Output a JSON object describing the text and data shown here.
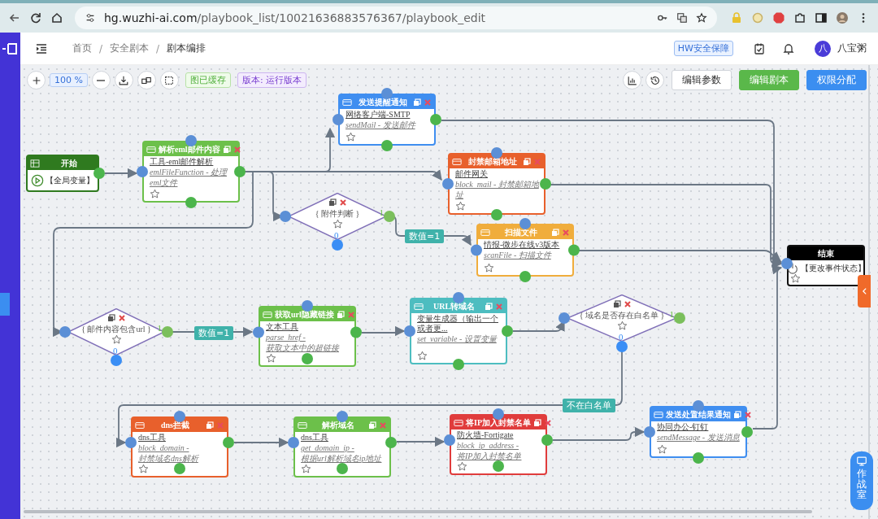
{
  "browser": {
    "host": "hg.wuzhi-ai.com",
    "path": "/playbook_list/10021636883576367/playbook_edit"
  },
  "header": {
    "breadcrumb": [
      {
        "label": "首页",
        "current": false
      },
      {
        "label": "安全剧本",
        "current": false
      },
      {
        "label": "剧本编排",
        "current": true
      }
    ],
    "separators": [
      "/",
      "/"
    ],
    "tag": "HW安全保障",
    "avatar_initial": "八",
    "user": "八宝粥"
  },
  "toolbar": {
    "zoom": "100 %",
    "cache_tag": "图已缓存",
    "version_tag": "版本: 运行版本",
    "buttons": [
      {
        "label": "编辑参数",
        "kind": "default"
      },
      {
        "label": "编辑剧本",
        "kind": "success"
      },
      {
        "label": "权限分配",
        "kind": "primary"
      }
    ]
  },
  "nodes": [
    {
      "kind": "start",
      "title": "开始",
      "body": "【全局变量】"
    },
    {
      "kind": "action",
      "title": "解析eml邮件内容",
      "color": "#6cc04a",
      "tool": "工具-eml邮件解析",
      "lines": [
        "emlFileFunction - 处理eml文件"
      ]
    },
    {
      "kind": "action",
      "title": "发送提醒通知",
      "color": "#3f8ef0",
      "tool": "网络客户端-SMTP",
      "lines": [
        "sendMail - 发送邮件"
      ]
    },
    {
      "kind": "action",
      "title": "封禁邮箱地址",
      "color": "#e8602c",
      "tool": "邮件网关",
      "lines": [
        "block_mail - 封禁邮箱地址"
      ]
    },
    {
      "kind": "condition",
      "label": "{ 附件判断 }",
      "true_label": "1",
      "false_label": "0"
    },
    {
      "kind": "action",
      "title": "扫描文件",
      "color": "#f0ad3c",
      "tool": "情报-微步在线v3版本",
      "lines": [
        "scanFile - 扫描文件"
      ]
    },
    {
      "kind": "end",
      "title": "结束",
      "body": "【更改事件状态】"
    },
    {
      "kind": "condition",
      "label": "{ 邮件内容包含url }",
      "true_label": "1",
      "false_label": "0"
    },
    {
      "kind": "action",
      "title": "获取url隐藏链接",
      "color": "#6cc04a",
      "tool": "文本工具",
      "lines": [
        "parse_href -",
        "获取文本中的超链接"
      ]
    },
    {
      "kind": "action",
      "title": "URL转域名",
      "color": "#4dbdc0",
      "tool": "变量生成器（输出一个或者更...",
      "lines": [
        "set_variable - 设置变量"
      ]
    },
    {
      "kind": "condition",
      "label": "{ 域名是否存在白名单 }",
      "true_label": "1",
      "false_label": "0"
    },
    {
      "kind": "action",
      "title": "dns拦截",
      "color": "#e8602c",
      "tool": "dns工具",
      "lines": [
        "block_domain -",
        "封禁域名dns解析"
      ]
    },
    {
      "kind": "action",
      "title": "解析域名",
      "color": "#6cc04a",
      "tool": "dns工具",
      "lines": [
        "get_domain_ip -",
        "根据url解析域名ip地址"
      ]
    },
    {
      "kind": "action",
      "title": "将IP加入封禁名单",
      "color": "#e03c3c",
      "tool": "防火墙-Fortigate",
      "lines": [
        "block_ip_address -",
        "将IP加入封禁名单"
      ]
    },
    {
      "kind": "action",
      "title": "发送处置结果通知",
      "color": "#3f8ef0",
      "tool": "协同办公-钉钉",
      "lines": [
        "sendMessage - 发送消息"
      ]
    }
  ],
  "edge_labels": [
    "数值=1",
    "数值=1",
    "不在白名单"
  ],
  "float_button": "作战室"
}
